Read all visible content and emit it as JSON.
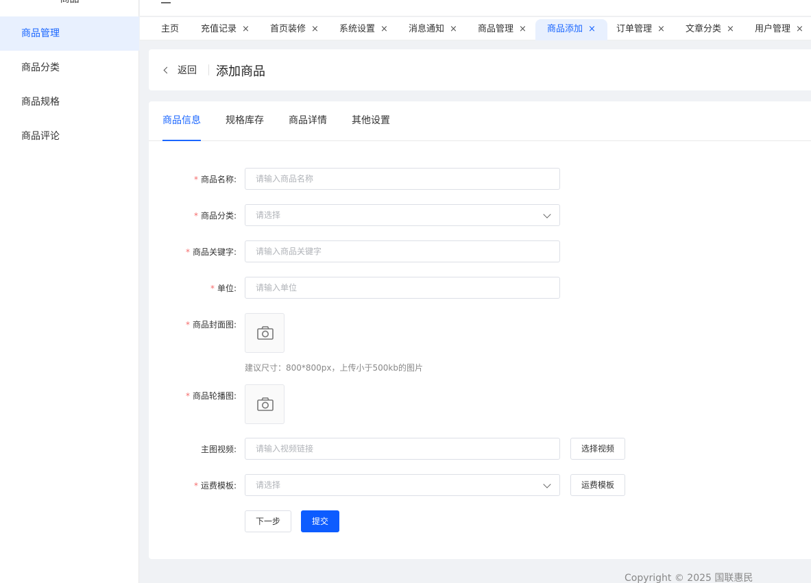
{
  "sidebar": {
    "title": "商品",
    "items": [
      {
        "label": "商品管理",
        "active": true
      },
      {
        "label": "商品分类",
        "active": false
      },
      {
        "label": "商品规格",
        "active": false
      },
      {
        "label": "商品评论",
        "active": false
      }
    ]
  },
  "tabs": [
    {
      "label": "主页",
      "closable": false
    },
    {
      "label": "充值记录",
      "closable": true
    },
    {
      "label": "首页装修",
      "closable": true
    },
    {
      "label": "系统设置",
      "closable": true
    },
    {
      "label": "消息通知",
      "closable": true
    },
    {
      "label": "商品管理",
      "closable": true
    },
    {
      "label": "商品添加",
      "closable": true,
      "active": true
    },
    {
      "label": "订单管理",
      "closable": true
    },
    {
      "label": "文章分类",
      "closable": true
    },
    {
      "label": "用户管理",
      "closable": true
    }
  ],
  "tab_close_glyph": "×",
  "header": {
    "back_label": "返回",
    "title": "添加商品"
  },
  "subtabs": [
    {
      "label": "商品信息",
      "active": true
    },
    {
      "label": "规格库存",
      "active": false
    },
    {
      "label": "商品详情",
      "active": false
    },
    {
      "label": "其他设置",
      "active": false
    }
  ],
  "form": {
    "required_mark": "*",
    "name": {
      "label": "商品名称:",
      "placeholder": "请输入商品名称",
      "value": ""
    },
    "category": {
      "label": "商品分类:",
      "placeholder": "请选择"
    },
    "keywords": {
      "label": "商品关键字:",
      "placeholder": "请输入商品关键字",
      "value": ""
    },
    "unit": {
      "label": "单位:",
      "placeholder": "请输入单位",
      "value": ""
    },
    "cover": {
      "label": "商品封面图:",
      "hint": "建议尺寸：800*800px，上传小于500kb的图片"
    },
    "carousel": {
      "label": "商品轮播图:"
    },
    "video": {
      "label": "主图视频:",
      "placeholder": "请输入视频链接",
      "value": "",
      "button": "选择视频"
    },
    "shipping": {
      "label": "运费模板:",
      "placeholder": "请选择",
      "button": "运费模板"
    },
    "next_button": "下一步",
    "submit_button": "提交"
  },
  "footer": "Copyright © 2025 国联惠民",
  "colors": {
    "accent": "#1a66ff",
    "primary_button": "#0d5cff",
    "active_bg": "#e8f0fe",
    "required": "#f56c6c"
  },
  "icons": {
    "menu": "hamburger-icon",
    "back": "chevron-left-icon",
    "tab_close": "close-icon",
    "select": "chevron-down-icon",
    "upload": "camera-icon"
  }
}
